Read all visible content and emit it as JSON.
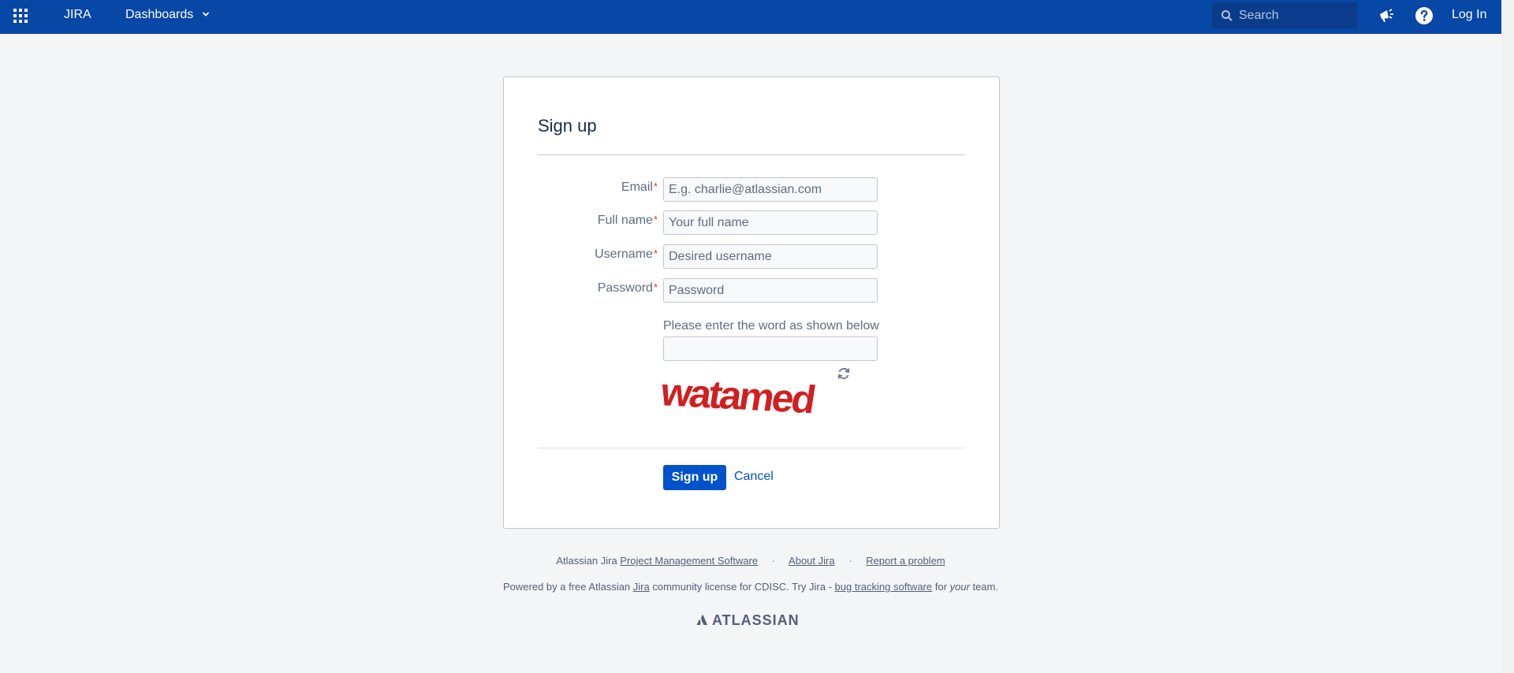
{
  "header": {
    "app_name": "JIRA",
    "dashboards_label": "Dashboards",
    "search_placeholder": "Search",
    "login_label": "Log In"
  },
  "form": {
    "title": "Sign up",
    "fields": [
      {
        "label": "Email",
        "placeholder": "E.g. charlie@atlassian.com",
        "required": "*"
      },
      {
        "label": "Full name",
        "placeholder": "Your full name",
        "required": "*"
      },
      {
        "label": "Username",
        "placeholder": "Desired username",
        "required": "*"
      },
      {
        "label": "Password",
        "placeholder": "Password",
        "required": "*"
      }
    ],
    "captcha_label": "Please enter the word as shown below",
    "captcha_word": "watamed",
    "signup_button": "Sign up",
    "cancel_link": "Cancel"
  },
  "footer": {
    "line1_prefix": "Atlassian Jira",
    "line1_link1": "Project Management Software",
    "line1_sep": "·",
    "line1_link2": "About Jira",
    "line1_link3": "Report a problem",
    "line2_prefix": "Powered by a free Atlassian",
    "line2_link1": "Jira",
    "line2_mid": "community license for CDISC. Try Jira -",
    "line2_link2": "bug tracking software",
    "line2_for": "for",
    "line2_your": "your",
    "line2_end": "team.",
    "brand": "ATLASSIAN"
  },
  "colors": {
    "header_bg": "#0747a6",
    "primary": "#0052cc",
    "required": "#de350b",
    "captcha": "#d11f1f"
  }
}
